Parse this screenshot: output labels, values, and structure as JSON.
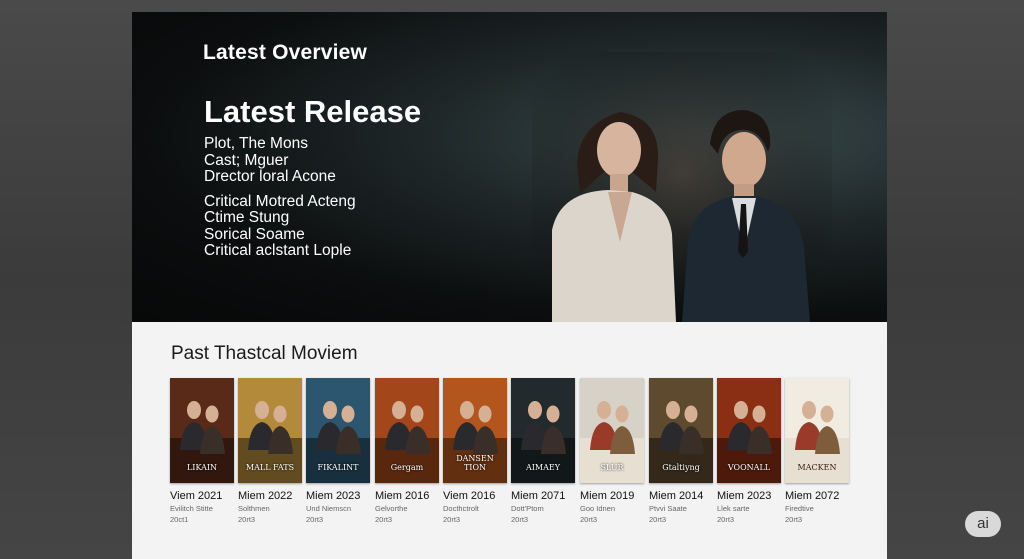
{
  "hero": {
    "overview_title": "Latest Overview",
    "release_title": "Latest Release",
    "details": [
      "Plot, The Mons",
      "Cast; Mguer",
      "Drector loral Acone"
    ],
    "critics": [
      "Critical Motred Acteng",
      "Ctime Stung",
      "Sorical Soame",
      "Critical aclstant Lople"
    ]
  },
  "past": {
    "title": "Past Thastcal Moviem",
    "movies": [
      {
        "title": "Viem 2021",
        "sub1": "Evilitch Stitte",
        "sub2": "20ct1",
        "poster_text": "LIKAIN",
        "color": "#5a2a18"
      },
      {
        "title": "Miem 2022",
        "sub1": "Solthmen",
        "sub2": "20rt3",
        "poster_text": "MALL FATS",
        "color": "#b38a3a"
      },
      {
        "title": "Miem 2023",
        "sub1": "Und Niemscn",
        "sub2": "20rt3",
        "poster_text": "FIKALINT",
        "color": "#2c5670"
      },
      {
        "title": "Miem 2016",
        "sub1": "Gelvorthe",
        "sub2": "20rt3",
        "poster_text": "Gergam",
        "color": "#a3471a"
      },
      {
        "title": "Viem 2016",
        "sub1": "Docthctrolt",
        "sub2": "20rt3",
        "poster_text": "DANSEN TION",
        "color": "#b2561d"
      },
      {
        "title": "Miem 2071",
        "sub1": "Dott'Ptom",
        "sub2": "20rt3",
        "poster_text": "AIMAEY",
        "color": "#222a2e"
      },
      {
        "title": "Miem 2019",
        "sub1": "Goo Idnen",
        "sub2": "20rt3",
        "poster_text": "SLUR",
        "color": "#d7d2c8"
      },
      {
        "title": "Miem 2014",
        "sub1": "Ptvvi Saate",
        "sub2": "20rt3",
        "poster_text": "Gtaltiyng",
        "color": "#5e4a2e"
      },
      {
        "title": "Miem 2023",
        "sub1": "Llek sarte",
        "sub2": "20rt3",
        "poster_text": "VOONALL",
        "color": "#8a2f13"
      },
      {
        "title": "Miem 2072",
        "sub1": "Firedtive",
        "sub2": "20rt3",
        "poster_text": "MACKEN",
        "color": "#f1ece2"
      }
    ]
  },
  "badge": {
    "label": "ai"
  }
}
